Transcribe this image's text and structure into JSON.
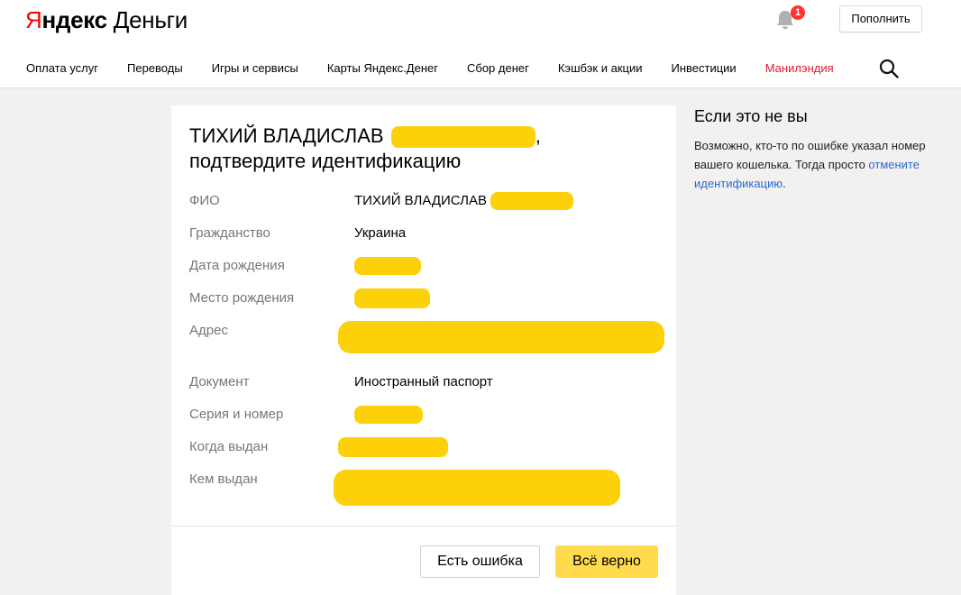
{
  "header": {
    "logo_y": "Я",
    "logo_brand_rest": "ндекс",
    "logo_service": "Деньги",
    "notification_count": "1",
    "topup_label": "Пополнить",
    "nav": [
      "Оплата услуг",
      "Переводы",
      "Игры и сервисы",
      "Карты Яндекс.Денег",
      "Сбор денег",
      "Кэшбэк и акции",
      "Инвестиции",
      "Манилэндия"
    ],
    "icons": {
      "notifications": "bell-icon",
      "search": "search-icon"
    }
  },
  "card": {
    "title_name": "ТИХИЙ ВЛАДИСЛАВ",
    "title_comma": ",",
    "title_line2": "подтвердите идентификацию",
    "fields": [
      {
        "label": "ФИО",
        "value": "ТИХИЙ ВЛАДИСЛАВ"
      },
      {
        "label": "Гражданство",
        "value": "Украина"
      },
      {
        "label": "Дата рождения",
        "value": ""
      },
      {
        "label": "Место рождения",
        "value": ""
      },
      {
        "label": "Адрес",
        "value": ""
      },
      {
        "label": "Документ",
        "value": "Иностранный паспорт"
      },
      {
        "label": "Серия и номер",
        "value": ""
      },
      {
        "label": "Когда выдан",
        "value": ""
      },
      {
        "label": "Кем выдан",
        "value": ""
      }
    ],
    "btn_error": "Есть ошибка",
    "btn_ok": "Всё верно"
  },
  "aside": {
    "title": "Если это не вы",
    "text": "Возможно, кто-то по ошибке указал номер вашего кошелька. Тогда просто ",
    "link": "отмените идентификацию",
    "tail": "."
  },
  "colors": {
    "accent_nav": "#e21b2e",
    "button_primary": "#ffdb4d",
    "link": "#2a6ad6",
    "redaction": "#fdd10a",
    "badge": "#ff3333"
  }
}
